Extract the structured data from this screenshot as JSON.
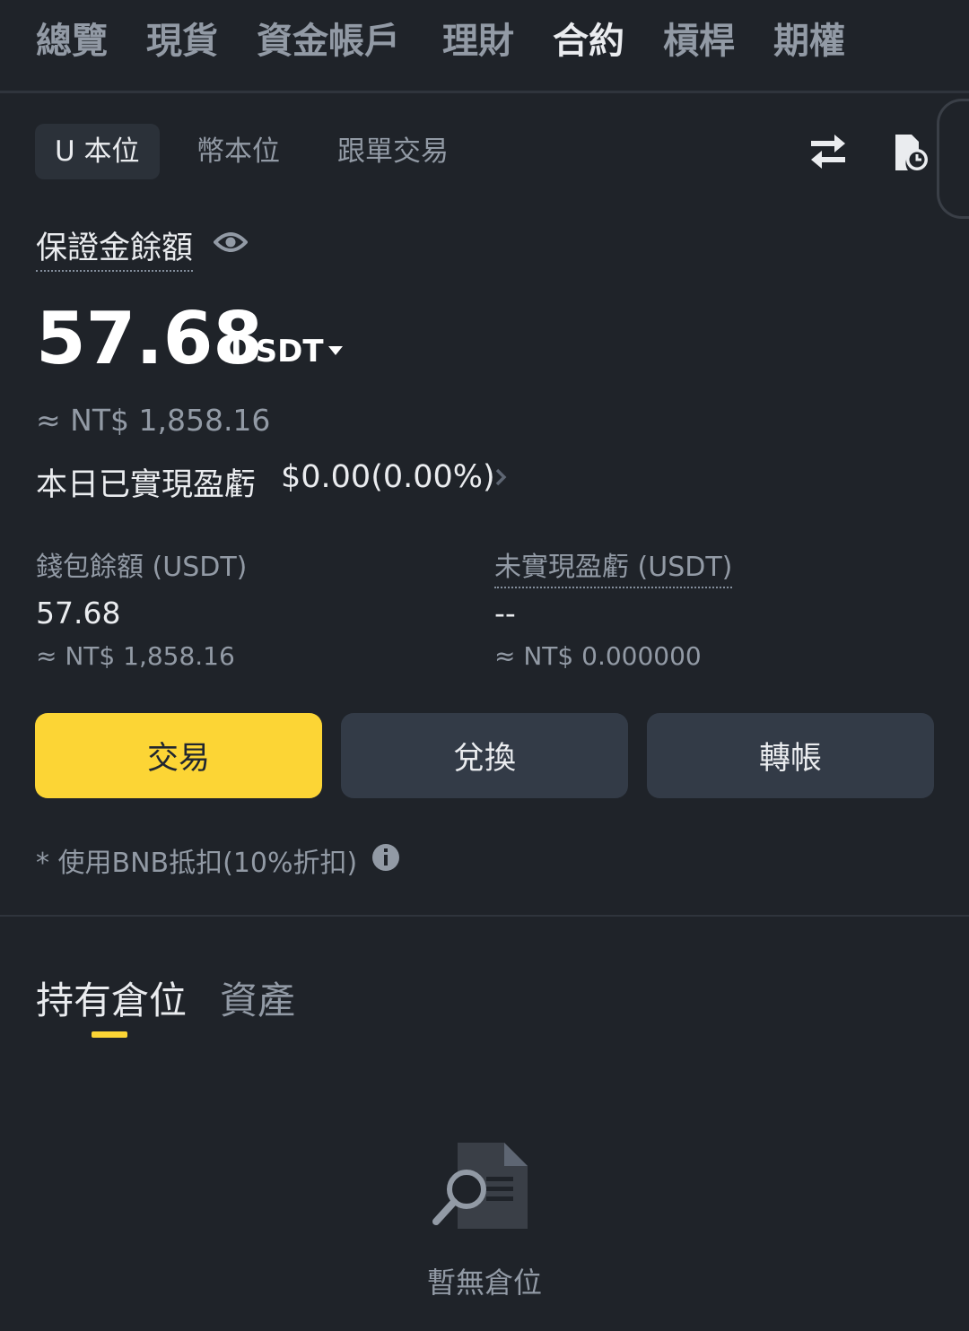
{
  "top_tabs": [
    {
      "label": "總覽"
    },
    {
      "label": "現貨"
    },
    {
      "label": "資金帳戶"
    },
    {
      "label": "理財"
    },
    {
      "label": "合約"
    },
    {
      "label": "槓桿"
    },
    {
      "label": "期權"
    }
  ],
  "active_top_tab": "合約",
  "sub_tabs": [
    {
      "label": "U 本位"
    },
    {
      "label": "幣本位"
    },
    {
      "label": "跟單交易"
    }
  ],
  "icons": {
    "transfer": "transfer-arrows-icon",
    "history": "order-history-icon",
    "visibility": "eye-icon",
    "dropdown": "caret-down-icon",
    "more": "chevron-right-icon",
    "info": "info-icon",
    "empty": "document-search-icon"
  },
  "margin_balance": {
    "label": "保證金餘額",
    "value": "57.68",
    "unit": "USDT",
    "approx": "≈ NT$ 1,858.16"
  },
  "daily_pnl": {
    "label": "本日已實現盈虧",
    "value": "$0.00(0.00%)"
  },
  "wallet": {
    "label": "錢包餘額 (USDT)",
    "value": "57.68",
    "approx": "≈ NT$ 1,858.16"
  },
  "unrealized": {
    "label": "未實現盈虧 (USDT)",
    "value": "--",
    "approx": "≈ NT$ 0.000000"
  },
  "buttons": {
    "trade": "交易",
    "convert": "兌換",
    "transfer": "轉帳"
  },
  "bnb_note": "* 使用BNB抵扣(10%折扣)",
  "position_tabs": [
    {
      "label": "持有倉位"
    },
    {
      "label": "資產"
    }
  ],
  "empty_state": "暫無倉位",
  "colors": {
    "background": "#1f2329",
    "accent": "#fcd535",
    "secondary_button": "#333b47",
    "muted_text": "#929aa5"
  }
}
